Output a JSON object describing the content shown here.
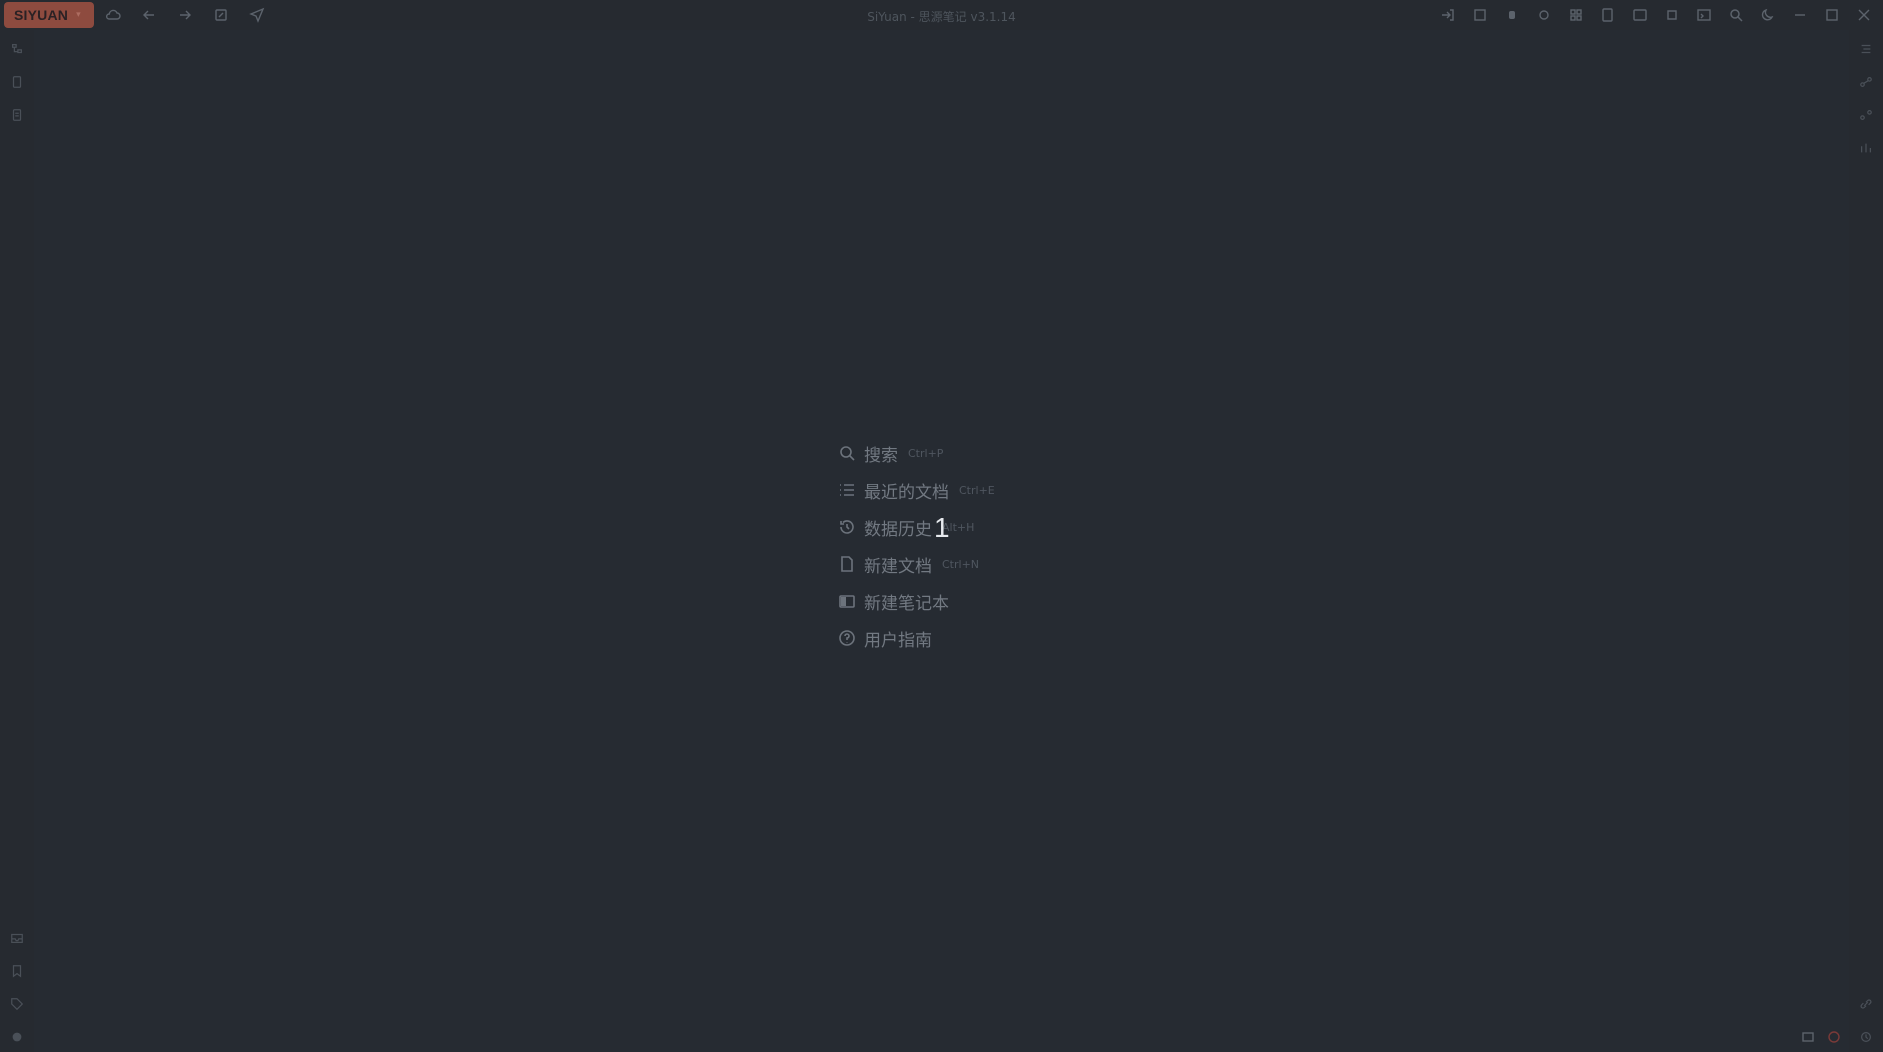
{
  "window": {
    "title": "SiYuan - 思源笔记 v3.1.14",
    "brand": "SIYUAN",
    "brand_caret": "▾"
  },
  "empty_state": {
    "items": [
      {
        "label": "搜索",
        "hotkey": "Ctrl+P",
        "icon": "search-icon"
      },
      {
        "label": "最近的文档",
        "hotkey": "Ctrl+E",
        "icon": "list-icon"
      },
      {
        "label": "数据历史",
        "hotkey": "Alt+H",
        "icon": "history-icon"
      },
      {
        "label": "新建文档",
        "hotkey": "Ctrl+N",
        "icon": "file-icon"
      },
      {
        "label": "新建笔记本",
        "hotkey": "",
        "icon": "notebook-icon"
      },
      {
        "label": "用户指南",
        "hotkey": "",
        "icon": "help-icon"
      }
    ]
  },
  "overlay": {
    "cursor_text": "1"
  },
  "colors": {
    "background": "#262b32",
    "brand": "#8e4b3f"
  }
}
